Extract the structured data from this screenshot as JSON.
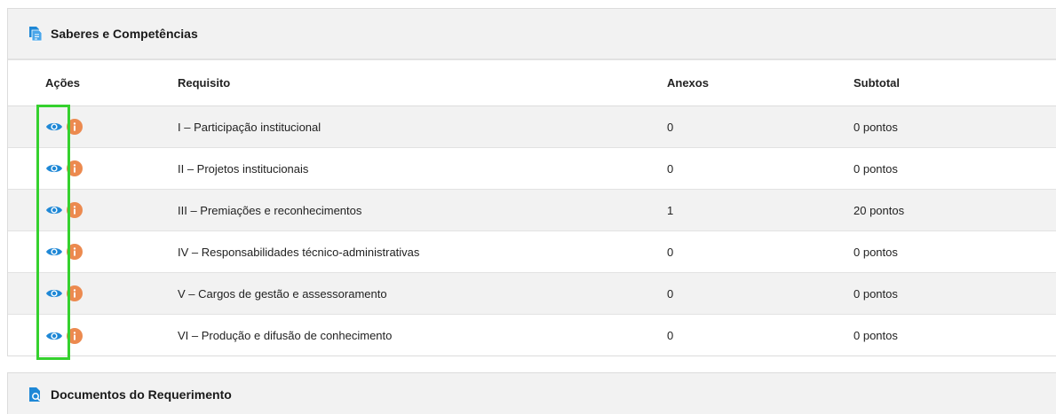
{
  "section1": {
    "title": "Saberes e Competências",
    "icon": "document-copy-icon"
  },
  "table": {
    "headers": {
      "acoes": "Ações",
      "requisito": "Requisito",
      "anexos": "Anexos",
      "subtotal": "Subtotal"
    },
    "rows": [
      {
        "requisito": "I – Participação institucional",
        "anexos": "0",
        "subtotal": "0 pontos"
      },
      {
        "requisito": "II – Projetos institucionais",
        "anexos": "0",
        "subtotal": "0 pontos"
      },
      {
        "requisito": "III – Premiações e reconhecimentos",
        "anexos": "1",
        "subtotal": "20 pontos"
      },
      {
        "requisito": "IV – Responsabilidades técnico-administrativas",
        "anexos": "0",
        "subtotal": "0 pontos"
      },
      {
        "requisito": "V – Cargos de gestão e assessoramento",
        "anexos": "0",
        "subtotal": "0 pontos"
      },
      {
        "requisito": "VI – Produção e difusão de conhecimento",
        "anexos": "0",
        "subtotal": "0 pontos"
      }
    ],
    "action_icons": [
      "eye-icon",
      "info-icon"
    ]
  },
  "section2": {
    "title": "Documentos do Requerimento",
    "icon": "document-search-icon"
  },
  "colors": {
    "eye_blue": "#1f88d6",
    "info_orange": "#ec8a4f",
    "header_icon_blue": "#1f88d6",
    "highlight_green": "#35d12e",
    "row_shade": "#f2f2f2"
  }
}
